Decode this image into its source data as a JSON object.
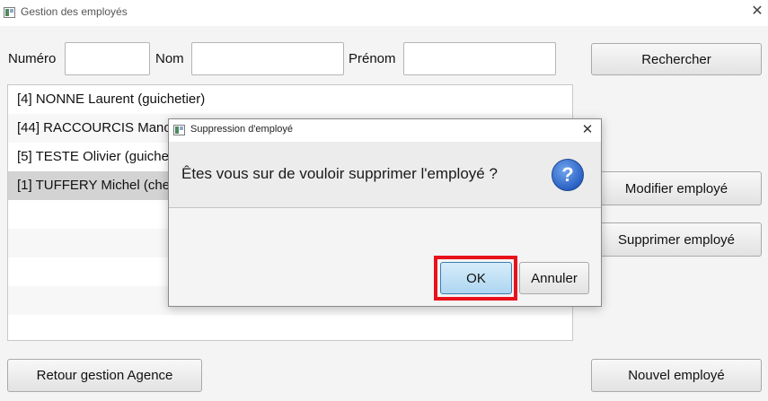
{
  "window": {
    "title": "Gestion des employés"
  },
  "search": {
    "numero_label": "Numéro",
    "nom_label": "Nom",
    "prenom_label": "Prénom",
    "numero_value": "",
    "nom_value": "",
    "prenom_value": "",
    "search_button": "Rechercher"
  },
  "employees": [
    "[4]  NONNE Laurent (guichetier)",
    "[44]  RACCOURCIS Manon (guichetier)",
    "[5]  TESTE Olivier (guichetier)",
    "[1]  TUFFERY Michel (chef d'agence)"
  ],
  "selected_index": 3,
  "actions": {
    "modify": "Modifier employé",
    "delete": "Supprimer employé",
    "back": "Retour gestion Agence",
    "new": "Nouvel employé"
  },
  "dialog": {
    "title": "Suppression d'employé",
    "message": "Êtes vous sur de vouloir supprimer l'employé ?",
    "ok": "OK",
    "cancel": "Annuler",
    "icon": "question-icon"
  },
  "colors": {
    "highlight": "#e8121b",
    "selection": "#d3d3d3",
    "ok_button": "#bfe0f5"
  }
}
